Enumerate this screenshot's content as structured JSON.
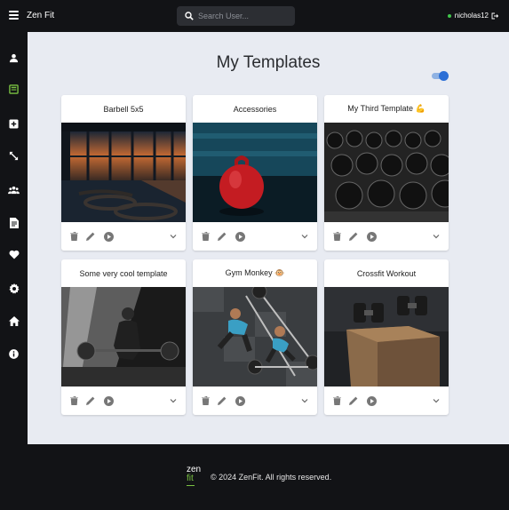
{
  "app": {
    "title": "Zen Fit"
  },
  "search": {
    "placeholder": "Search User..."
  },
  "user": {
    "name": "nicholas12",
    "status_color": "#3fc64a"
  },
  "sidebar": {
    "items": [
      {
        "icon": "person-icon"
      },
      {
        "icon": "templates-icon"
      },
      {
        "icon": "add-box-icon"
      },
      {
        "icon": "expand-icon"
      },
      {
        "icon": "group-icon"
      },
      {
        "icon": "document-icon"
      },
      {
        "icon": "heart-icon"
      },
      {
        "icon": "settings-icon"
      },
      {
        "icon": "home-icon"
      },
      {
        "icon": "info-icon"
      }
    ]
  },
  "main": {
    "title": "My Templates",
    "toggle_on": true,
    "accent": "#2c6fd6"
  },
  "templates": [
    {
      "title": "Barbell 5x5"
    },
    {
      "title": "Accessories"
    },
    {
      "title": "My Third Template 💪"
    },
    {
      "title": "Some very cool template"
    },
    {
      "title": "Gym Monkey 🐵"
    },
    {
      "title": "Crossfit Workout"
    }
  ],
  "footer": {
    "logo_top": "zen",
    "logo_bottom": "fit",
    "copyright": "© 2024 ZenFit. All rights reserved."
  }
}
